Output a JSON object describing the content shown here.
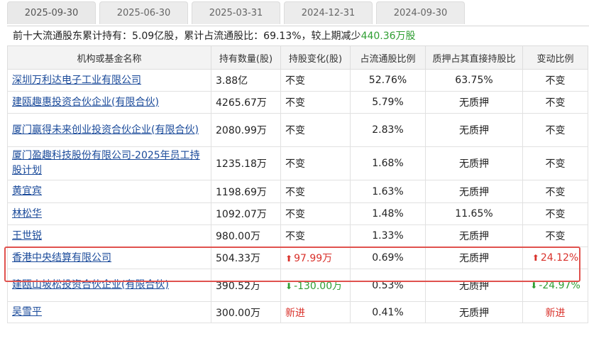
{
  "tabs": [
    "2025-09-30",
    "2025-06-30",
    "2025-03-31",
    "2024-12-31",
    "2024-09-30"
  ],
  "summary": {
    "prefix": "前十大流通股东累计持有：5.09亿股，累计占流通股比：69.13%，较上期减少",
    "change": "440.36万股"
  },
  "headers": [
    "机构或基金名称",
    "持有数量(股)",
    "持股变化(股)",
    "占流通股比例",
    "质押占其直接持股比",
    "变动比例"
  ],
  "rows": [
    {
      "name": "深圳万利达电子工业有限公司",
      "qty": "3.88亿",
      "chg": "不变",
      "pct": "52.76%",
      "pledge": "63.75%",
      "ratio": "不变"
    },
    {
      "name": "建瓯趣惠投资合伙企业(有限合伙)",
      "qty": "4265.67万",
      "chg": "不变",
      "pct": "5.79%",
      "pledge": "无质押",
      "ratio": "不变"
    },
    {
      "name": "厦门赢得未来创业投资合伙企业(有限合伙)",
      "qty": "2080.99万",
      "chg": "不变",
      "pct": "2.83%",
      "pledge": "无质押",
      "ratio": "不变"
    },
    {
      "name": "厦门盈趣科技股份有限公司-2025年员工持股计划",
      "qty": "1235.18万",
      "chg": "不变",
      "pct": "1.68%",
      "pledge": "无质押",
      "ratio": "不变"
    },
    {
      "name": "黄宜宾",
      "qty": "1198.69万",
      "chg": "不变",
      "pct": "1.63%",
      "pledge": "无质押",
      "ratio": "不变"
    },
    {
      "name": "林松华",
      "qty": "1092.07万",
      "chg": "不变",
      "pct": "1.48%",
      "pledge": "11.65%",
      "ratio": "不变"
    },
    {
      "name": "王世锐",
      "qty": "980.00万",
      "chg": "不变",
      "pct": "1.33%",
      "pledge": "无质押",
      "ratio": "不变"
    },
    {
      "name": "香港中央结算有限公司",
      "qty": "504.33万",
      "chg": "97.99万",
      "chg_dir": "up",
      "pct": "0.69%",
      "pledge": "无质押",
      "ratio": "24.12%",
      "ratio_dir": "up"
    },
    {
      "name": "建瓯山坡松投资合伙企业(有限合伙)",
      "qty": "390.52万",
      "chg": "-130.00万",
      "chg_dir": "down",
      "pct": "0.53%",
      "pledge": "无质押",
      "ratio": "-24.97%",
      "ratio_dir": "down"
    },
    {
      "name": "吴雪平",
      "qty": "300.00万",
      "chg": "新进",
      "chg_dir": "new",
      "pct": "0.41%",
      "pledge": "无质押",
      "ratio": "新进",
      "ratio_dir": "new"
    }
  ],
  "colors": {
    "up": "#d9312b",
    "down": "#2f9e32",
    "link": "#1a4a9a",
    "highlight": "#e0524e"
  }
}
